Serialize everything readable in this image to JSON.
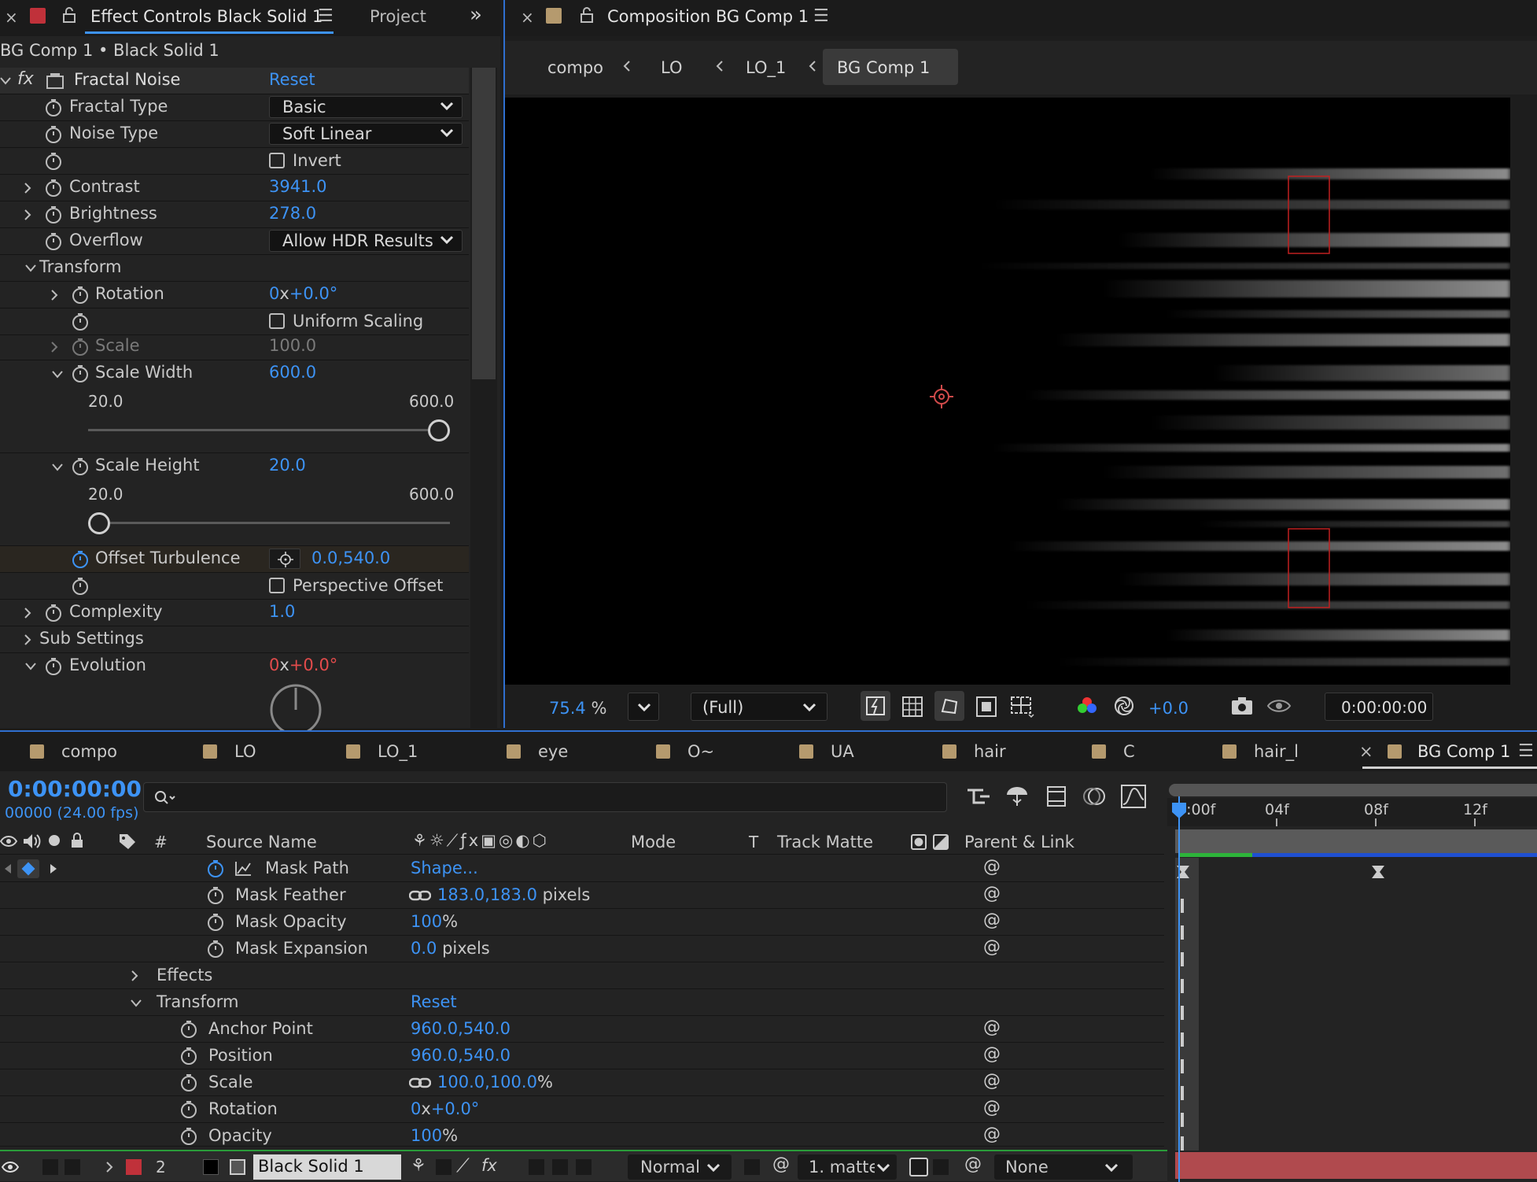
{
  "effect_panel": {
    "tab_title": "Effect Controls Black Solid 1",
    "tab_project": "Project",
    "breadcrumb": "BG Comp 1 • Black Solid 1",
    "effect_name": "Fractal Noise",
    "reset": "Reset",
    "fractal_type": {
      "label": "Fractal Type",
      "value": "Basic"
    },
    "noise_type": {
      "label": "Noise Type",
      "value": "Soft Linear"
    },
    "invert": {
      "label": "Invert"
    },
    "contrast": {
      "label": "Contrast",
      "value": "3941.0"
    },
    "brightness": {
      "label": "Brightness",
      "value": "278.0"
    },
    "overflow": {
      "label": "Overflow",
      "value": "Allow HDR Results"
    },
    "transform": {
      "label": "Transform"
    },
    "rotation": {
      "label": "Rotation",
      "rev": "0",
      "x": "x",
      "deg": "+0.0°"
    },
    "uniform_scaling": {
      "label": "Uniform Scaling"
    },
    "scale": {
      "label": "Scale",
      "value": "100.0"
    },
    "scale_width": {
      "label": "Scale Width",
      "value": "600.0",
      "min": "20.0",
      "max": "600.0",
      "fraction": 1.0
    },
    "scale_height": {
      "label": "Scale Height",
      "value": "20.0",
      "min": "20.0",
      "max": "600.0",
      "fraction": 0.0
    },
    "offset_turbulence": {
      "label": "Offset Turbulence",
      "x": "0.0",
      "comma": ",",
      "y": "540.0"
    },
    "perspective_offset": {
      "label": "Perspective Offset"
    },
    "complexity": {
      "label": "Complexity",
      "value": "1.0"
    },
    "sub_settings": {
      "label": "Sub Settings"
    },
    "evolution": {
      "label": "Evolution",
      "rev": "0",
      "x": "x",
      "deg": "+0.0°"
    }
  },
  "comp_panel": {
    "tab_title": "Composition BG Comp 1",
    "crumbs": [
      "compo",
      "LO",
      "LO_1",
      "BG Comp 1"
    ],
    "zoom": "75.4",
    "zoom_unit": "%",
    "resolution": "(Full)",
    "exposure": "+0.0",
    "timecode": "0:00:00:00"
  },
  "timeline": {
    "tabs": [
      "compo",
      "LO",
      "LO_1",
      "eye",
      "O~",
      "UA",
      "hair",
      "C",
      "hair_l",
      "BG Comp 1"
    ],
    "close": "×",
    "timecode": "0:00:00:00",
    "frames": "00000 (24.00 fps)",
    "ruler": [
      "0:00f",
      "04f",
      "08f",
      "12f"
    ],
    "headers": {
      "hash": "#",
      "source_name": "Source Name",
      "mode": "Mode",
      "t": "T",
      "track_matte": "Track Matte",
      "parent": "Parent & Link"
    },
    "rows": {
      "mask_path": {
        "label": "Mask Path",
        "value": "Shape..."
      },
      "mask_feather": {
        "label": "Mask Feather",
        "v1": "183.0",
        "comma": ",",
        "v2": "183.0",
        "unit": "pixels"
      },
      "mask_opacity": {
        "label": "Mask Opacity",
        "value": "100",
        "unit": "%"
      },
      "mask_expansion": {
        "label": "Mask Expansion",
        "value": "0.0",
        "unit": "pixels"
      },
      "effects": {
        "label": "Effects"
      },
      "transform": {
        "label": "Transform",
        "reset": "Reset"
      },
      "anchor_point": {
        "label": "Anchor Point",
        "v1": "960.0",
        "comma": ",",
        "v2": "540.0"
      },
      "position": {
        "label": "Position",
        "v1": "960.0",
        "comma": ",",
        "v2": "540.0"
      },
      "scale": {
        "label": "Scale",
        "v1": "100.0",
        "comma": ",",
        "v2": "100.0",
        "unit": "%"
      },
      "rotation": {
        "label": "Rotation",
        "rev": "0",
        "x": "x",
        "deg": "+0.0°"
      },
      "opacity": {
        "label": "Opacity",
        "value": "100",
        "unit": "%"
      }
    },
    "layer": {
      "number": "2",
      "name": "Black Solid 1",
      "mode": "Normal",
      "matte": "1. matte",
      "parent": "None"
    }
  },
  "colors": {
    "accent": "#3d93f5",
    "label_red": "#c0313a",
    "label_tan": "#b59a6e",
    "green_bar": "#2db33a",
    "blue_bar": "#1f4fd1"
  }
}
